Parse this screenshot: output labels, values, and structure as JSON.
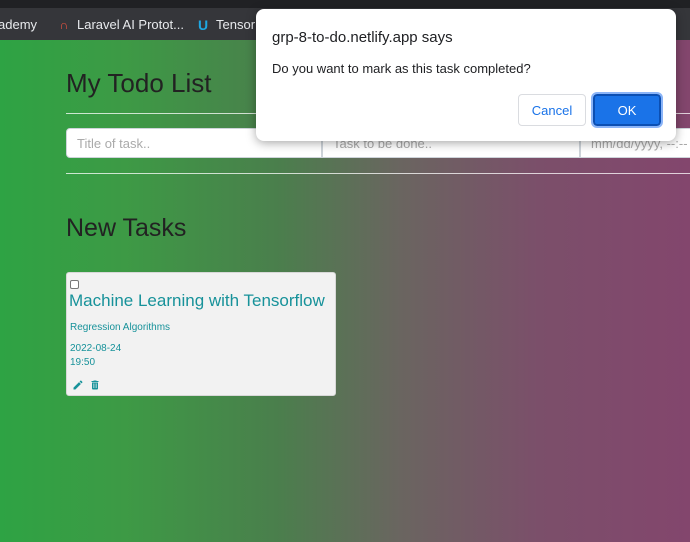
{
  "bookmarks": [
    {
      "label": "ademy",
      "icon": "none"
    },
    {
      "label": "Laravel AI Protot...",
      "icon": "laravel-icon"
    },
    {
      "label": "Tensor",
      "icon": "tensorflow-icon"
    }
  ],
  "app": {
    "title": "My Todo List",
    "form": {
      "title_placeholder": "Title of task..",
      "desc_placeholder": "Task to be done..",
      "date_placeholder": "mm/dd/yyyy, --:--"
    },
    "section_title": "New Tasks",
    "tasks": [
      {
        "title": "Machine Learning with Tensorflow",
        "description": "Regression Algorithms",
        "date": "2022-08-24",
        "time": "19:50",
        "completed": false
      }
    ]
  },
  "dialog": {
    "title": "grp-8-to-do.netlify.app says",
    "message": "Do you want to mark as this task completed?",
    "cancel_label": "Cancel",
    "ok_label": "OK"
  },
  "colors": {
    "accent": "#1a73e8",
    "task_text": "#17929a",
    "gradient_left": "#2ea344",
    "gradient_right": "#83466d"
  }
}
